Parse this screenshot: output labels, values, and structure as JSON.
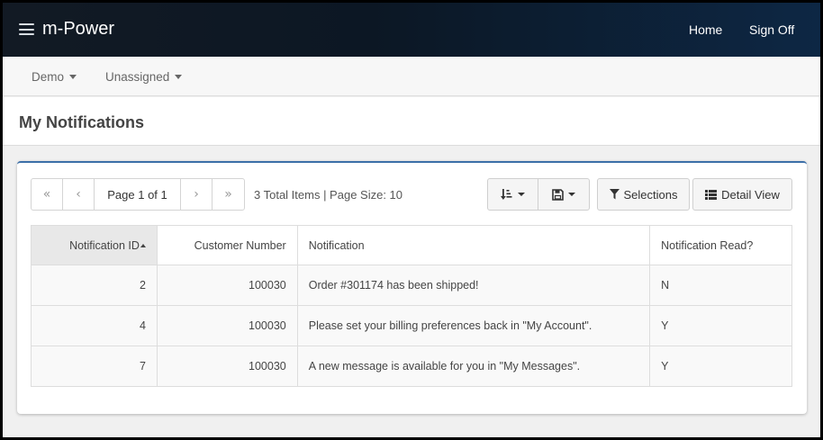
{
  "app": {
    "brand": "m-Power"
  },
  "nav": {
    "home": "Home",
    "sign_off": "Sign Off"
  },
  "subnav": {
    "demo": "Demo",
    "unassigned": "Unassigned"
  },
  "page": {
    "title": "My Notifications"
  },
  "pager": {
    "first": "«",
    "prev": "‹",
    "label": "Page 1 of 1",
    "next": "›",
    "last": "»",
    "totals": "3 Total Items | Page Size: 10"
  },
  "toolbar": {
    "selections": "Selections",
    "detail_view": "Detail View"
  },
  "table": {
    "headers": [
      "Notification ID",
      "Customer Number",
      "Notification",
      "Notification Read?"
    ],
    "rows": [
      [
        "2",
        "100030",
        "Order #301174 has been shipped!",
        "N"
      ],
      [
        "4",
        "100030",
        "Please set your billing preferences back in \"My Account\".",
        "Y"
      ],
      [
        "7",
        "100030",
        "A new message is available for you in \"My Messages\".",
        "Y"
      ]
    ]
  },
  "colors": {
    "accent": "#3c6fa8",
    "topbar": "#0d1a2a"
  },
  "icons": [
    "menu-icon",
    "sort-icon",
    "save-icon",
    "filter-icon",
    "list-icon"
  ]
}
